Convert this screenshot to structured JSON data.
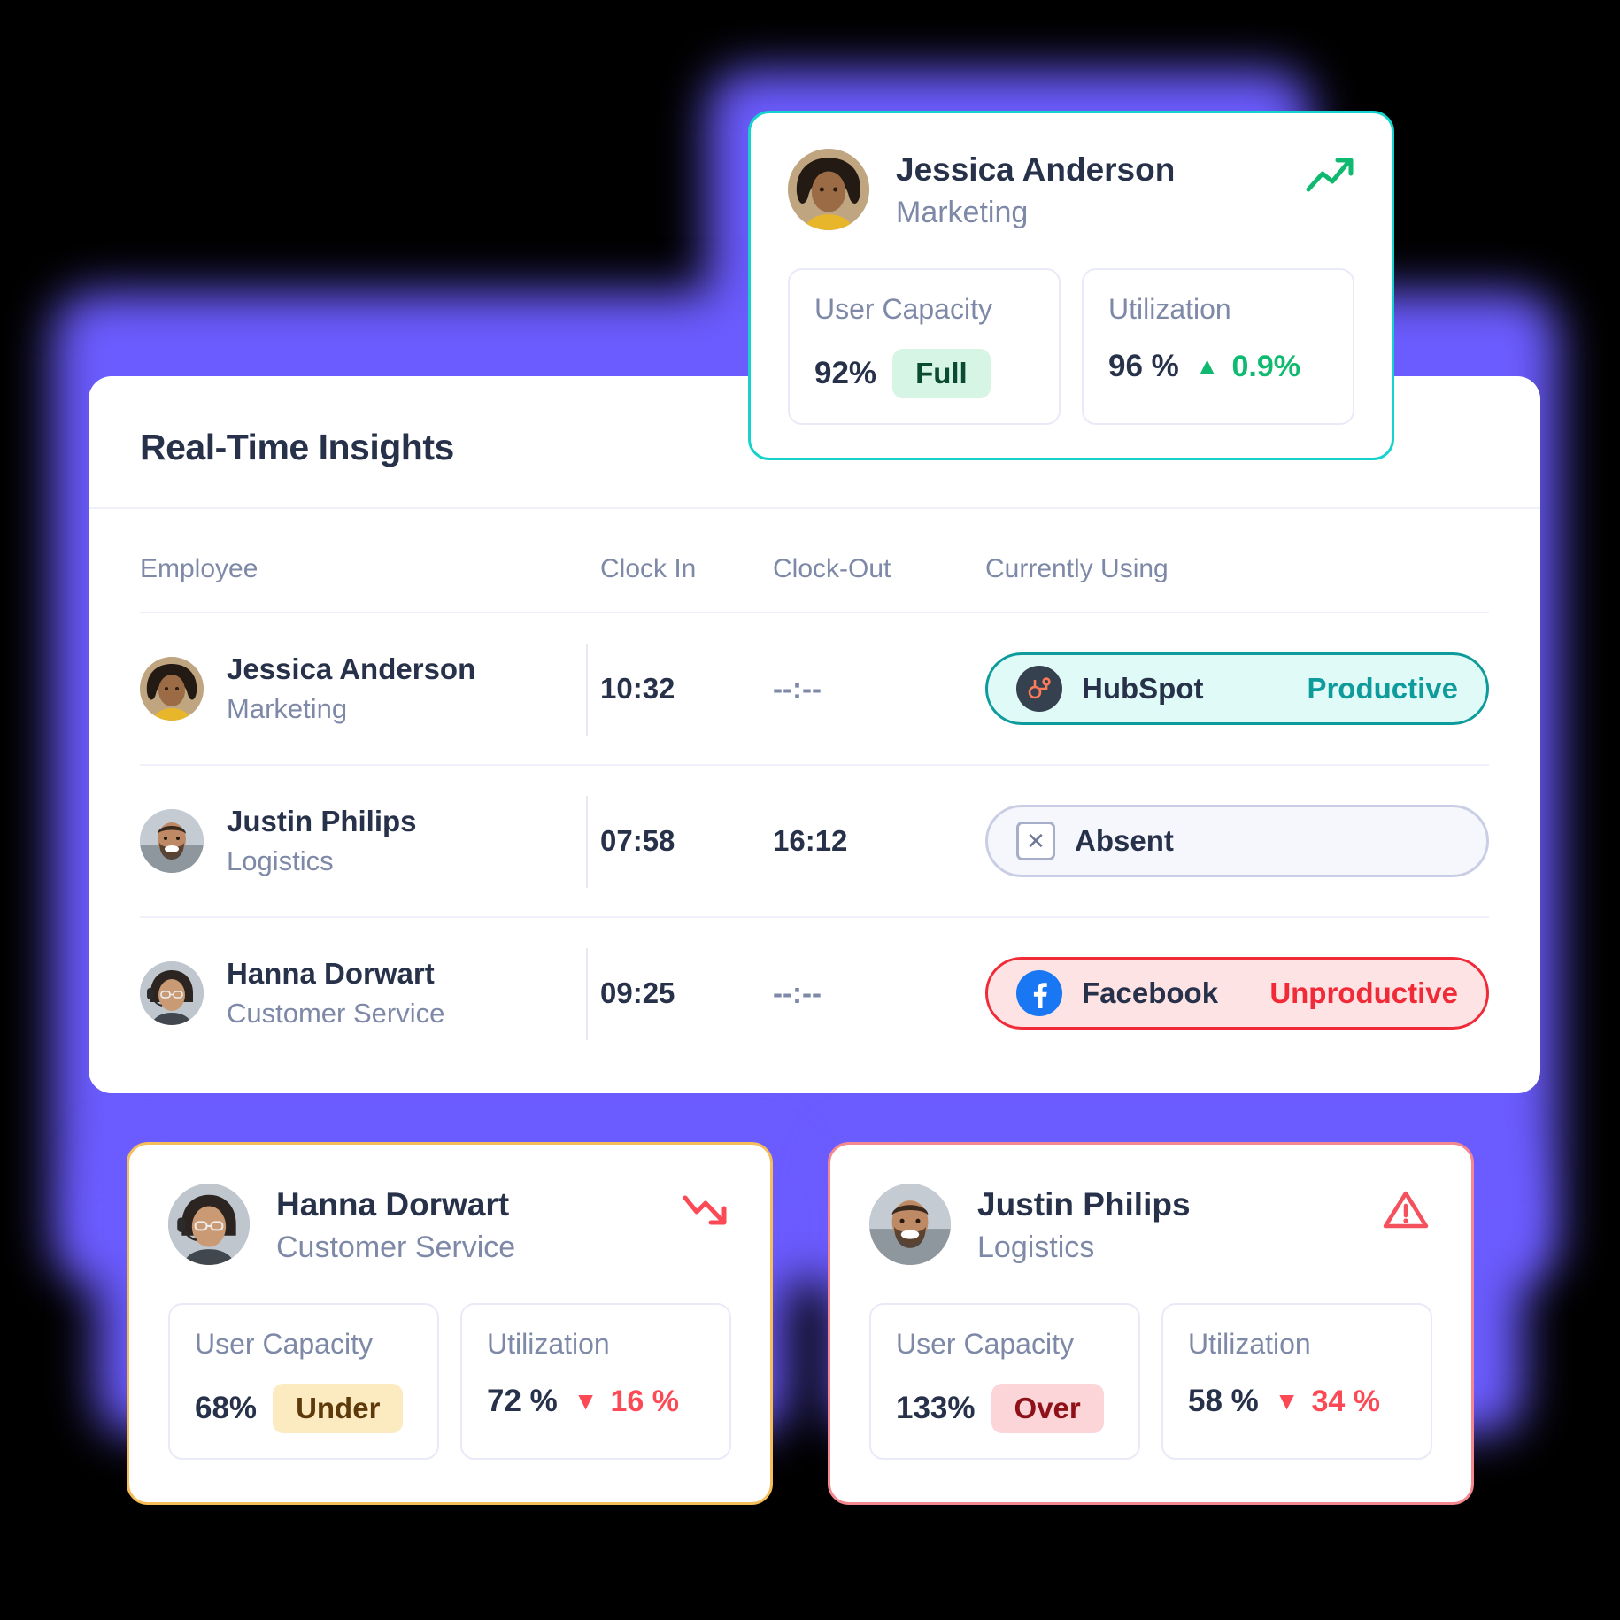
{
  "panel": {
    "title": "Real-Time Insights"
  },
  "table": {
    "headers": {
      "employee": "Employee",
      "clock_in": "Clock In",
      "clock_out": "Clock-Out",
      "currently_using": "Currently Using"
    },
    "rows": [
      {
        "name": "Jessica Anderson",
        "role": "Marketing",
        "clock_in": "10:32",
        "clock_out": "--:--",
        "status": {
          "app": "HubSpot",
          "tag": "Productive",
          "icon": "hubspot-icon",
          "style": "productive"
        }
      },
      {
        "name": "Justin Philips",
        "role": "Logistics",
        "clock_in": "07:58",
        "clock_out": "16:12",
        "status": {
          "app": "Absent",
          "tag": "",
          "icon": "absent-icon",
          "style": "absent"
        }
      },
      {
        "name": "Hanna Dorwart",
        "role": "Customer Service",
        "clock_in": "09:25",
        "clock_out": "--:--",
        "status": {
          "app": "Facebook",
          "tag": "Unproductive",
          "icon": "facebook-icon",
          "style": "unproductive"
        }
      }
    ]
  },
  "cards": {
    "top": {
      "name": "Jessica Anderson",
      "role": "Marketing",
      "trend_icon": "trend-up-icon",
      "capacity_label": "User Capacity",
      "capacity_value": "92%",
      "capacity_chip": "Full",
      "utilization_label": "Utilization",
      "utilization_value": "96 %",
      "delta_caret": "▲",
      "delta_value": "0.9%"
    },
    "bottom_left": {
      "name": "Hanna Dorwart",
      "role": "Customer Service",
      "trend_icon": "trend-down-icon",
      "capacity_label": "User Capacity",
      "capacity_value": "68%",
      "capacity_chip": "Under",
      "utilization_label": "Utilization",
      "utilization_value": "72 %",
      "delta_caret": "▼",
      "delta_value": "16 %"
    },
    "bottom_right": {
      "name": "Justin Philips",
      "role": "Logistics",
      "trend_icon": "warning-icon",
      "capacity_label": "User Capacity",
      "capacity_value": "133%",
      "capacity_chip": "Over",
      "utilization_label": "Utilization",
      "utilization_value": "58 %",
      "delta_caret": "▼",
      "delta_value": "34 %"
    }
  },
  "colors": {
    "backdrop_purple": "#6B5CFF",
    "accent_teal": "#15D3CC",
    "accent_amber": "#F5BE5A",
    "accent_red": "#F4888E",
    "productive": "#0E9B9B",
    "unproductive": "#F02B37",
    "positive_green": "#0FBA70",
    "negative_red": "#FB4A55"
  }
}
